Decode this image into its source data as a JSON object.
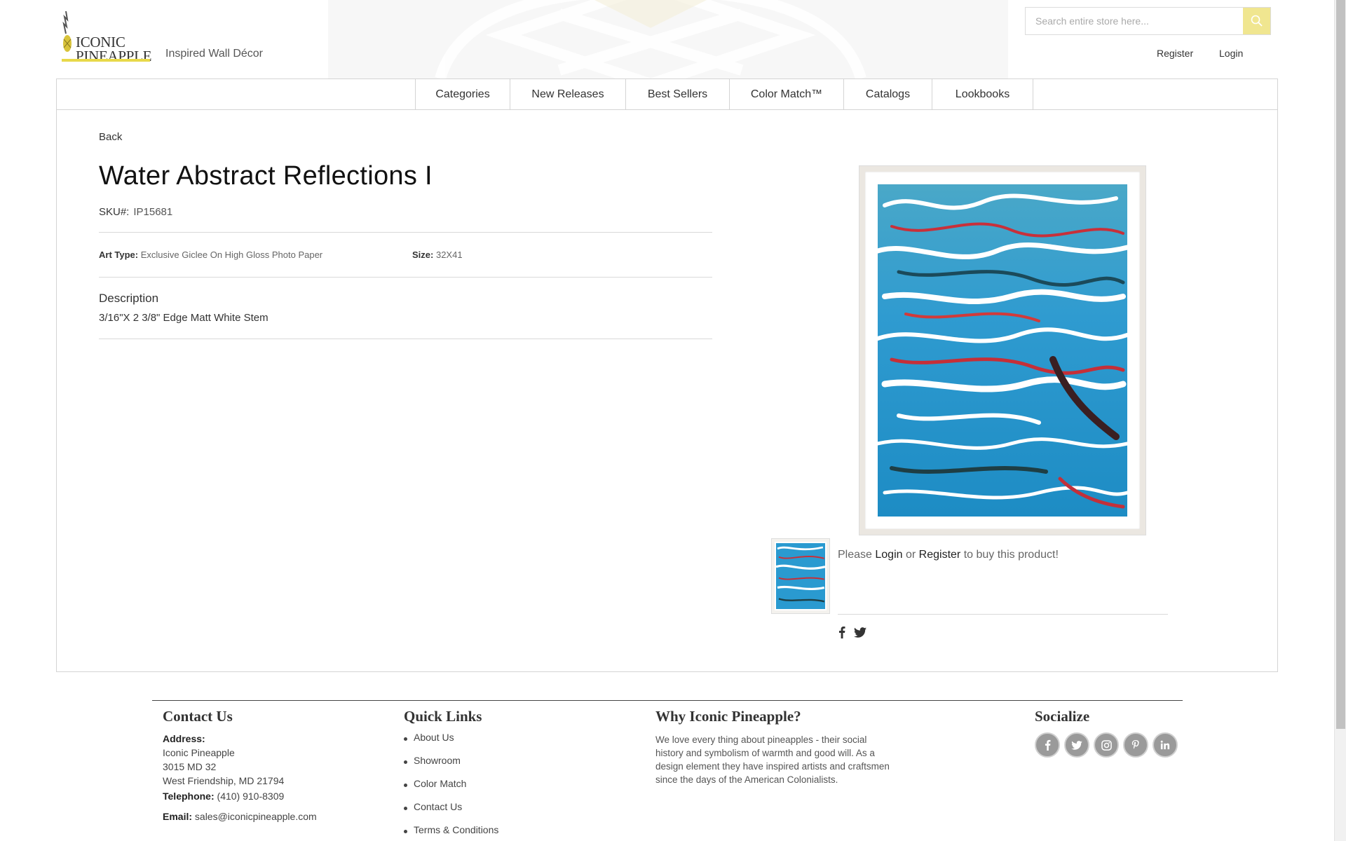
{
  "header": {
    "logo_text_line1": "ICONIC",
    "logo_text_line2": "PINEAPPLE",
    "tagline": "Inspired Wall Décor",
    "search_placeholder": "Search entire store here...",
    "register_label": "Register",
    "login_label": "Login",
    "accent_color": "#f0e690"
  },
  "nav": {
    "items": [
      {
        "label": "Categories"
      },
      {
        "label": "New Releases"
      },
      {
        "label": "Best Sellers"
      },
      {
        "label": "Color Match™"
      },
      {
        "label": "Catalogs"
      },
      {
        "label": "Lookbooks"
      }
    ]
  },
  "product": {
    "back_label": "Back",
    "title": "Water Abstract Reflections I",
    "sku_label": "SKU#:",
    "sku_value": "IP15681",
    "art_type_label": "Art Type:",
    "art_type_value": "Exclusive Giclee On High Gloss Photo Paper",
    "size_label": "Size:",
    "size_value": "32X41",
    "description_heading": "Description",
    "description_text": "3/16\"X 2 3/8\" Edge Matt White Stem",
    "buy_prefix": "Please",
    "buy_login": "Login",
    "buy_or": "or",
    "buy_register": "Register",
    "buy_suffix": "to buy this product!"
  },
  "footer": {
    "contact_heading": "Contact Us",
    "address_label": "Address:",
    "address_line1": "Iconic Pineapple",
    "address_line2": "3015 MD 32",
    "address_line3": "West Friendship, MD 21794",
    "telephone_label": "Telephone:",
    "telephone_value": "(410) 910-8309",
    "email_label": "Email:",
    "email_value": "sales@iconicpineapple.com",
    "quicklinks_heading": "Quick Links",
    "quicklinks": [
      {
        "label": "About Us"
      },
      {
        "label": "Showroom"
      },
      {
        "label": "Color Match"
      },
      {
        "label": "Contact Us"
      },
      {
        "label": "Terms & Conditions"
      }
    ],
    "why_heading": "Why Iconic Pineapple?",
    "why_text": "We love every thing about pineapples - their social history and symbolism of warmth and good will. As a design element they have inspired artists and craftsmen since the days of the American Colonialists.",
    "socialize_heading": "Socialize",
    "social_icons": [
      "facebook-icon",
      "twitter-icon",
      "instagram-icon",
      "pinterest-icon",
      "linkedin-icon"
    ]
  }
}
